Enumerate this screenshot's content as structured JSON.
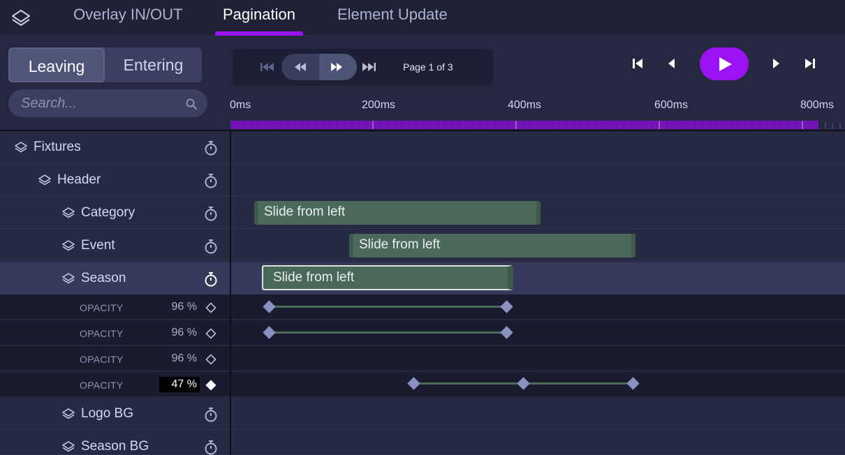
{
  "tabs": [
    {
      "label": "Overlay IN/OUT"
    },
    {
      "label": "Pagination"
    },
    {
      "label": "Element Update"
    }
  ],
  "mode_toggle": {
    "leaving": "Leaving",
    "entering": "Entering"
  },
  "search": {
    "placeholder": "Search..."
  },
  "pagination": {
    "label": "Page 1 of 3"
  },
  "timeline": {
    "ticks": [
      "0ms",
      "200ms",
      "400ms",
      "600ms",
      "800ms"
    ]
  },
  "layers": [
    {
      "name": "Fixtures"
    },
    {
      "name": "Header"
    },
    {
      "name": "Category",
      "clip": "Slide from left"
    },
    {
      "name": "Event",
      "clip": "Slide from left"
    },
    {
      "name": "Season",
      "clip": "Slide from left"
    },
    {
      "name": "Logo BG"
    },
    {
      "name": "Season BG"
    }
  ],
  "properties": [
    {
      "name": "OPACITY",
      "value": "96 %"
    },
    {
      "name": "OPACITY",
      "value": "96 %"
    },
    {
      "name": "OPACITY",
      "value": "96 %"
    },
    {
      "name": "OPACITY",
      "value": "47 %"
    }
  ],
  "colors": {
    "accent": "#9b12f5",
    "clip": "#4b6a5c",
    "keyframe": "#8a90c0"
  }
}
